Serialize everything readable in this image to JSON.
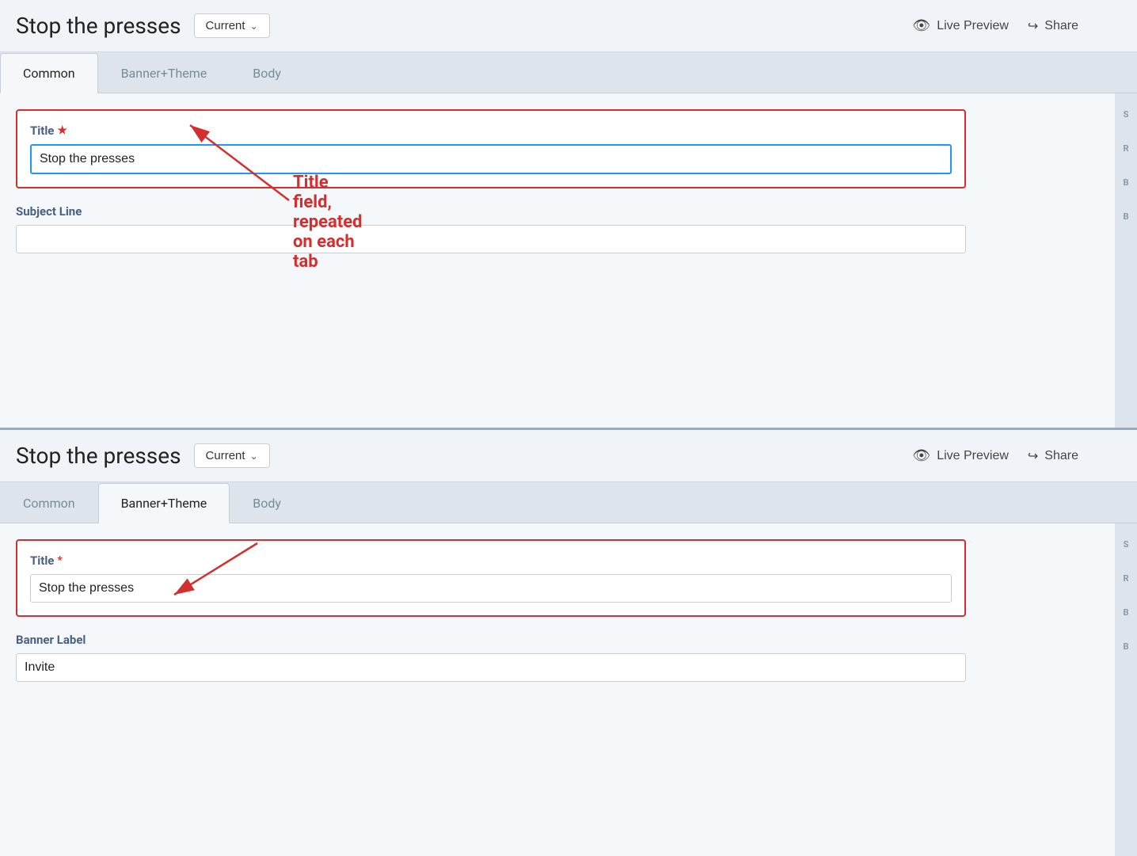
{
  "page": {
    "title": "Stop the presses"
  },
  "header": {
    "title": "Stop the presses",
    "version_label": "Current",
    "live_preview_label": "Live Preview",
    "share_label": "Share"
  },
  "tabs_top": [
    {
      "id": "common",
      "label": "Common",
      "active": true
    },
    {
      "id": "banner_theme",
      "label": "Banner+Theme",
      "active": false
    },
    {
      "id": "body",
      "label": "Body",
      "active": false
    }
  ],
  "tabs_bottom": [
    {
      "id": "common2",
      "label": "Common",
      "active": false
    },
    {
      "id": "banner_theme2",
      "label": "Banner+Theme",
      "active": true
    },
    {
      "id": "body2",
      "label": "Body",
      "active": false
    }
  ],
  "form_top": {
    "title_label": "Title",
    "title_required": "★",
    "title_value": "Stop the presses",
    "title_placeholder": "",
    "subject_label": "Subject Line",
    "subject_value": "",
    "subject_placeholder": ""
  },
  "form_bottom": {
    "title_label": "Title",
    "title_required": "★",
    "title_value": "Stop the presses",
    "title_placeholder": "",
    "banner_label": "Banner Label",
    "banner_value": "Invite",
    "banner_placeholder": ""
  },
  "annotation": {
    "text": "Title field, repeated on each tab"
  },
  "sidebar_top": {
    "items": [
      "S",
      "R",
      "B",
      "B"
    ]
  },
  "sidebar_bottom": {
    "items": [
      "S",
      "R",
      "B",
      "B"
    ]
  },
  "icons": {
    "eye": "👁",
    "share": "↪",
    "chevron": "∨"
  }
}
